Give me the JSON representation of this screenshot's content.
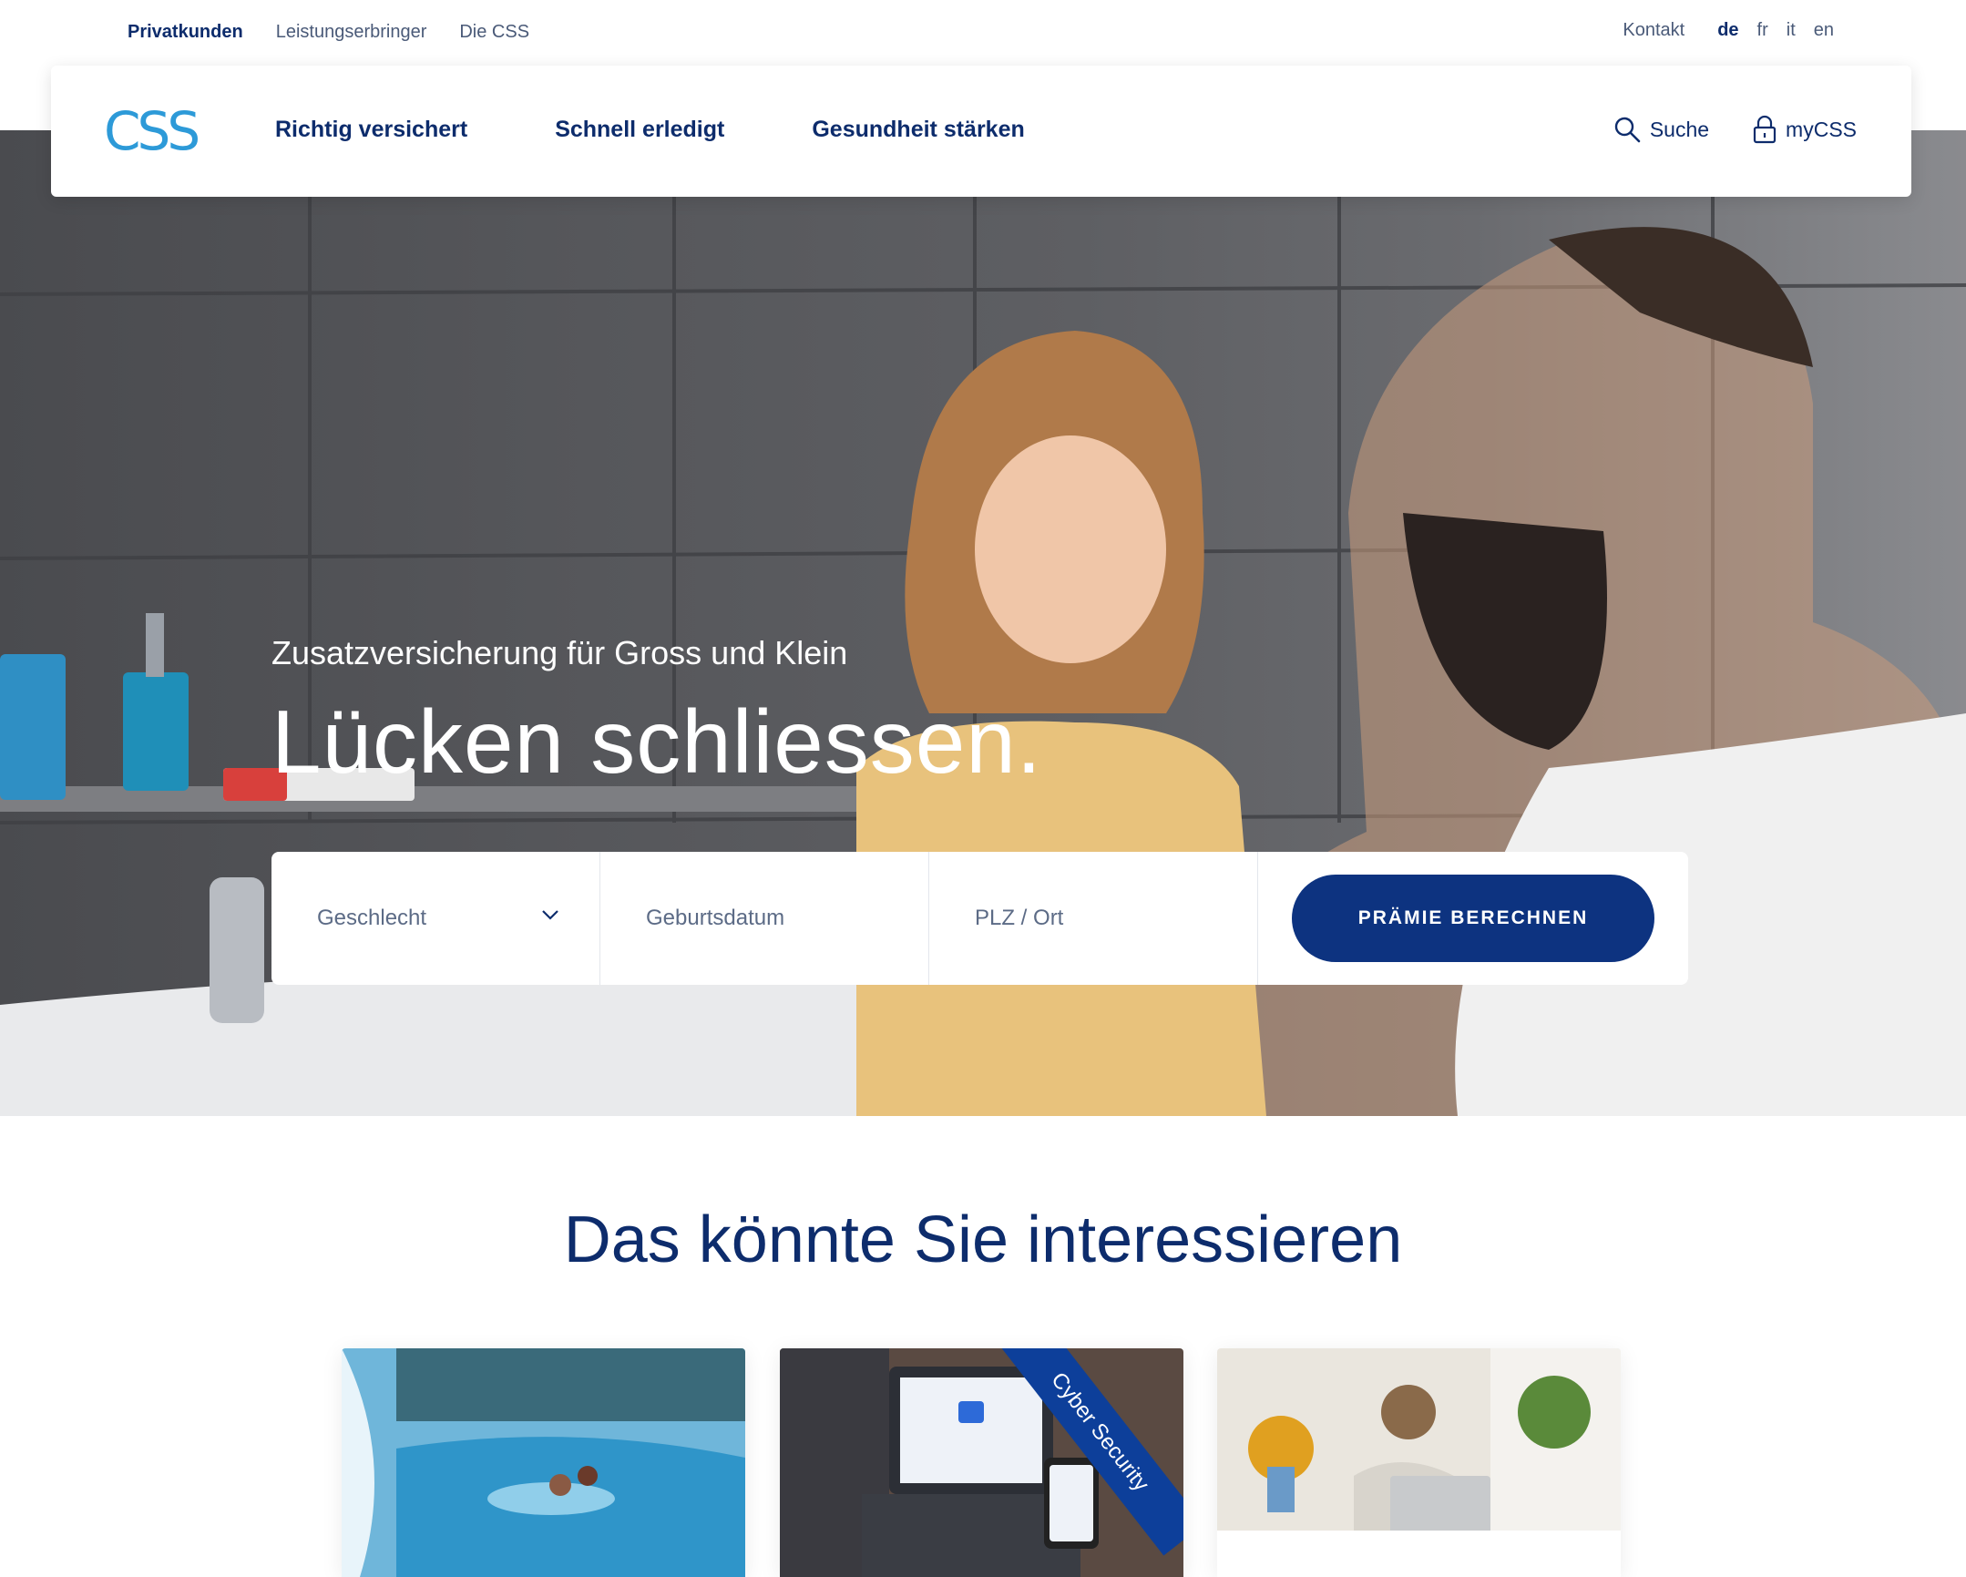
{
  "meta_nav": {
    "left": [
      {
        "label": "Privatkunden",
        "active": true
      },
      {
        "label": "Leistungserbringer",
        "active": false
      },
      {
        "label": "Die CSS",
        "active": false
      }
    ],
    "contact": "Kontakt",
    "languages": [
      {
        "label": "de",
        "active": true
      },
      {
        "label": "fr",
        "active": false
      },
      {
        "label": "it",
        "active": false
      },
      {
        "label": "en",
        "active": false
      }
    ]
  },
  "brand": {
    "logo_text": "CSS",
    "logo_color": "#2d9ad8"
  },
  "main_nav": {
    "items": [
      "Richtig versichert",
      "Schnell erledigt",
      "Gesundheit stärken"
    ],
    "search": {
      "label": "Suche",
      "icon": "search-icon"
    },
    "account": {
      "label": "myCSS",
      "icon": "lock-icon"
    }
  },
  "hero": {
    "subtitle": "Zusatzversicherung für Gross und Klein",
    "title": "Lücken schliessen.",
    "form": {
      "gender_placeholder": "Geschlecht",
      "birthdate_placeholder": "Geburtsdatum",
      "zip_placeholder": "PLZ / Ort",
      "cta_label": "PRÄMIE BERECHNEN"
    }
  },
  "interests": {
    "title": "Das könnte Sie interessieren",
    "cards": [
      {
        "image": "thermal-pool-photo"
      },
      {
        "image": "laptop-authentication-photo",
        "ribbon": "Cyber Security"
      },
      {
        "image": "couple-laptop-photo"
      }
    ]
  },
  "colors": {
    "primary": "#0d2c6c",
    "button": "#0d3380",
    "accent": "#2d9ad8"
  }
}
